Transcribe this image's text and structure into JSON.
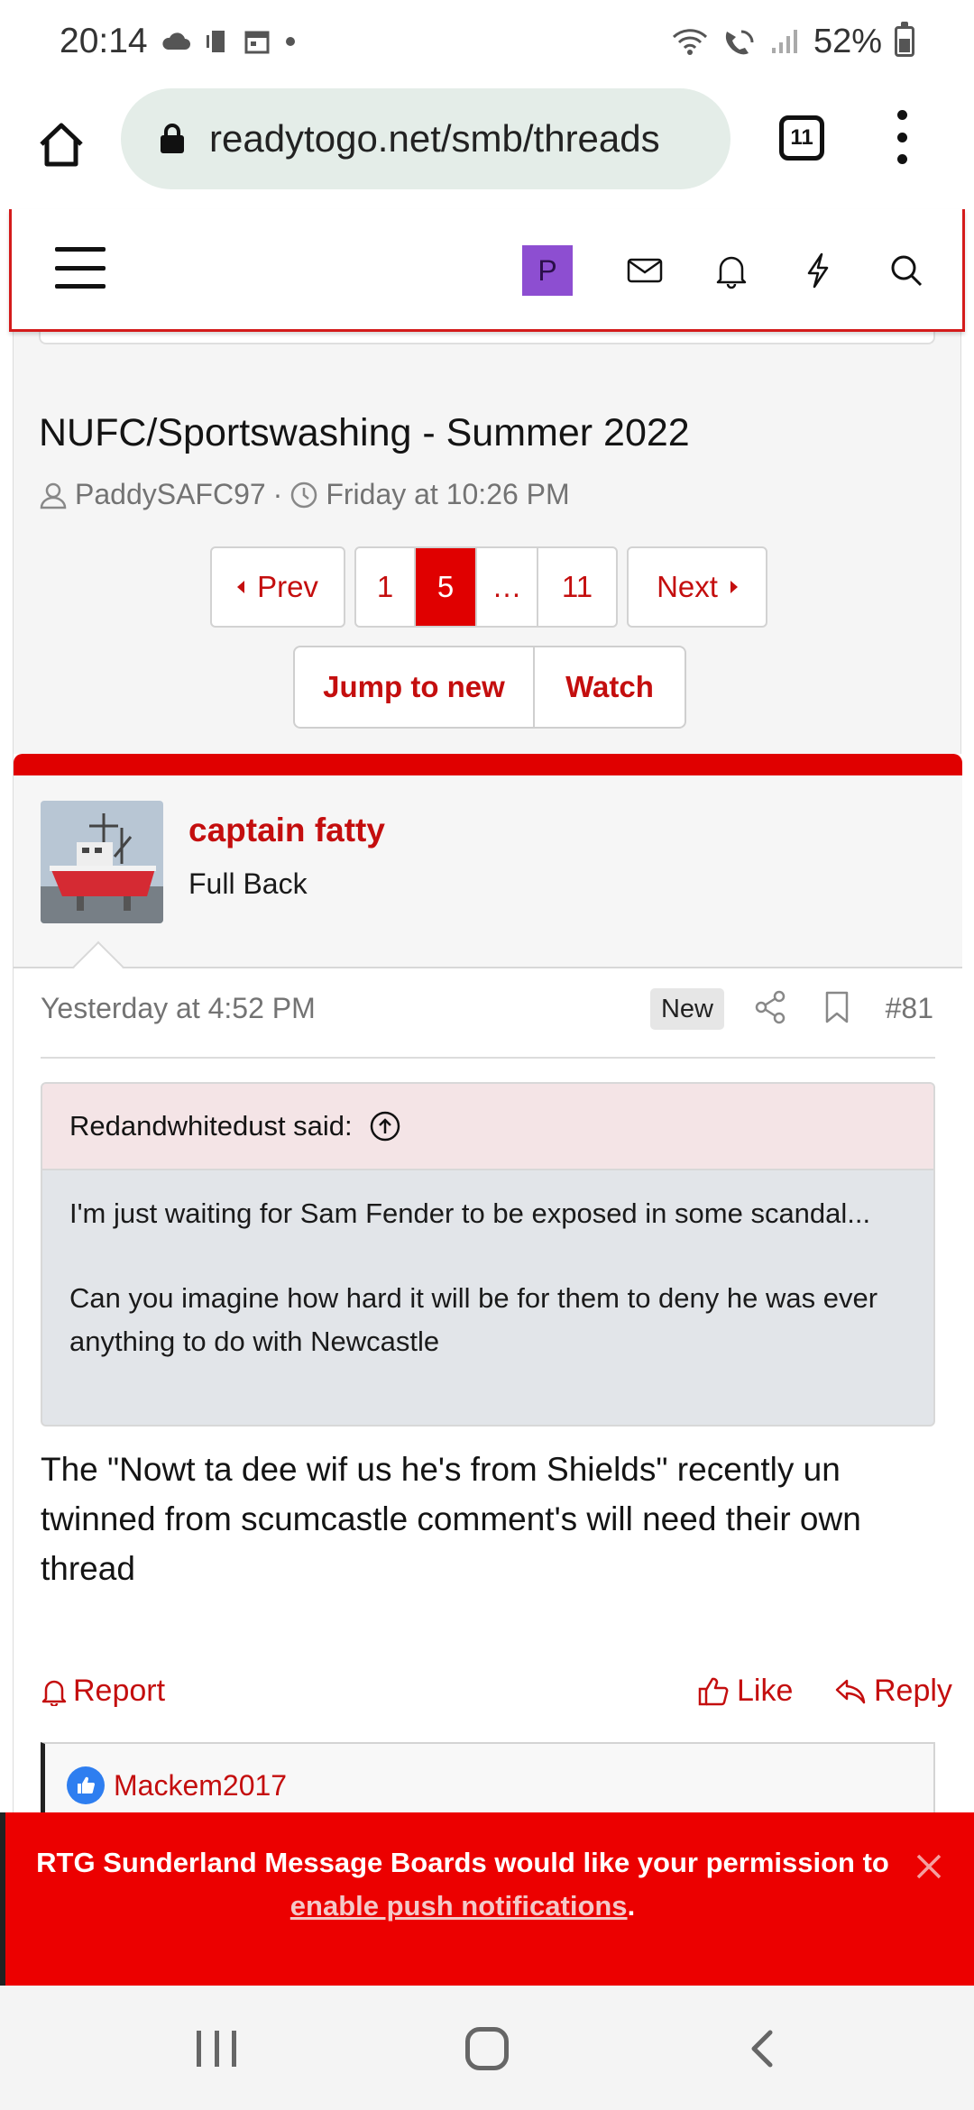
{
  "status_bar": {
    "time": "20:14",
    "battery": "52%",
    "battery_level": 0.52
  },
  "browser": {
    "url": "readytogo.net/smb/threads",
    "tab_count": "11"
  },
  "site_header": {
    "avatar_letter": "P",
    "accent_color": "#8d4ed1"
  },
  "thread": {
    "title": "NUFC/Sportswashing - Summer 2022",
    "author": "PaddySAFC97",
    "separator": "·",
    "date": "Friday at 10:26 PM"
  },
  "pagination": {
    "prev": "Prev",
    "pages": [
      "1",
      "5",
      "…",
      "11"
    ],
    "current": "5",
    "next": "Next"
  },
  "thread_actions": {
    "jump": "Jump to new",
    "watch": "Watch"
  },
  "post": {
    "username": "captain fatty",
    "user_title": "Full Back",
    "date": "Yesterday at 4:52 PM",
    "badge": "New",
    "number": "#81",
    "quote": {
      "author": "Redandwhitedust said:",
      "paragraph1": "I'm just waiting for Sam Fender to be exposed in some scandal...",
      "paragraph2": "Can you imagine how hard it will be for them to deny he was ever anything to do with Newcastle"
    },
    "body": "The \"Nowt ta dee wif us he's from Shields\" recently un twinned from scumcastle comment's will need their own thread",
    "actions": {
      "report": "Report",
      "like": "Like",
      "reply": "Reply"
    },
    "reactions_user": "Mackem2017"
  },
  "push_notice": {
    "text_before": "RTG Sunderland Message Boards would like your permission to ",
    "link": "enable push notifications",
    "text_after": "."
  },
  "colors": {
    "brand_red": "#e00000",
    "link_red": "#c40e0e"
  }
}
